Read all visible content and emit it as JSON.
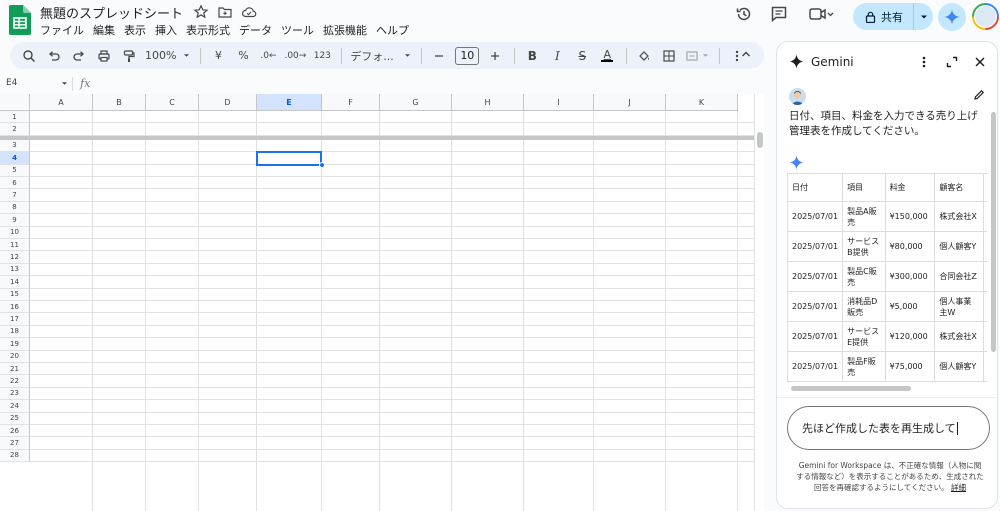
{
  "app": {
    "title": "無題のスプレッドシート",
    "menu": [
      "ファイル",
      "編集",
      "表示",
      "挿入",
      "表示形式",
      "データ",
      "ツール",
      "拡張機能",
      "ヘルプ"
    ],
    "share_label": "共有"
  },
  "toolbar": {
    "zoom": "100%",
    "currency": "¥",
    "percent": "%",
    "decrease_decimal": ".0←",
    "increase_decimal": ".00→",
    "number_format": "123",
    "font": "デフォ...",
    "font_size": "10",
    "bold": "B",
    "italic": "I",
    "strike": "S",
    "text_color": "A"
  },
  "formula_bar": {
    "cell_ref": "E4",
    "fx": "fx",
    "value": ""
  },
  "grid": {
    "columns": [
      "A",
      "B",
      "C",
      "D",
      "E",
      "F",
      "G",
      "H",
      "I",
      "J",
      "K"
    ],
    "selected_column": "E",
    "rows": [
      "1",
      "2",
      "3",
      "4",
      "5",
      "6",
      "7",
      "8",
      "9",
      "10",
      "11",
      "12",
      "13",
      "14",
      "15",
      "16",
      "17",
      "18",
      "19",
      "20",
      "21",
      "22",
      "23",
      "24",
      "25",
      "26",
      "27",
      "28"
    ],
    "selected_row": "4"
  },
  "gemini": {
    "title": "Gemini",
    "user_prompt": "日付、項目、料金を入力できる売り上げ管理表を作成してください。",
    "table": {
      "headers": [
        "日付",
        "項目",
        "料金",
        "顧客名"
      ],
      "rows": [
        [
          "2025/07/01",
          "製品A販売",
          "¥150,000",
          "株式会社X"
        ],
        [
          "2025/07/01",
          "サービスB提供",
          "¥80,000",
          "個人顧客Y"
        ],
        [
          "2025/07/01",
          "製品C販売",
          "¥300,000",
          "合同会社Z"
        ],
        [
          "2025/07/01",
          "消耗品D販売",
          "¥5,000",
          "個人事業主W"
        ],
        [
          "2025/07/01",
          "サービスE提供",
          "¥120,000",
          "株式会社X"
        ],
        [
          "2025/07/01",
          "製品F販売",
          "¥75,000",
          "個人顧客Y"
        ]
      ]
    },
    "input_value": "先ほど作成した表を再生成して",
    "disclaimer": "Gemini for Workspace は、不正確な情報（人物に関する情報など）を表示することがあるため、生成された回答を再確認するようにしてください。",
    "disclaimer_link": "詳細"
  },
  "colors": {
    "accent": "#1a73e8",
    "share_bg": "#c2e7ff",
    "sheets_green": "#0f9d58"
  }
}
